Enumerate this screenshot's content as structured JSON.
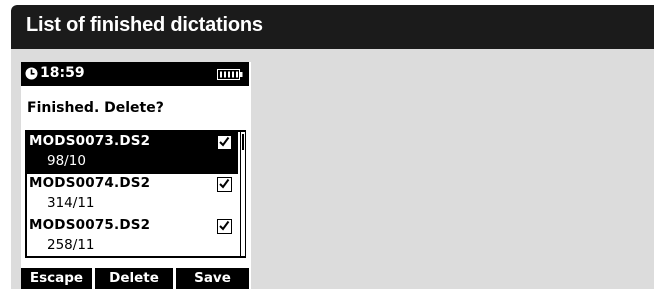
{
  "window": {
    "title": "List of finished dictations"
  },
  "status_bar": {
    "time": "18:59",
    "clock_icon": "clock-icon",
    "battery_icon": "battery-icon"
  },
  "prompt": {
    "text": "Finished. Delete?"
  },
  "dictations": [
    {
      "name": "MODS0073.DS2",
      "detail": "98/10",
      "checked": true,
      "selected": true
    },
    {
      "name": "MODS0074.DS2",
      "detail": "314/11",
      "checked": true,
      "selected": false
    },
    {
      "name": "MODS0075.DS2",
      "detail": "258/11",
      "checked": true,
      "selected": false
    }
  ],
  "softkeys": {
    "escape": "Escape",
    "delete": "Delete",
    "save": "Save"
  },
  "colors": {
    "title_bar": "#1b1b1b",
    "panel_bg": "#dcdcdc",
    "screen_bg": "#ffffff",
    "ink": "#000000"
  }
}
